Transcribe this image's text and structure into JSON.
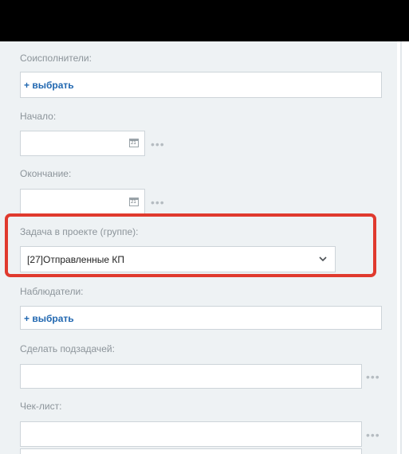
{
  "form": {
    "coexecutors_label": "Соисполнители:",
    "coexecutors_pick": "+ выбрать",
    "start_label": "Начало:",
    "start_value": "",
    "end_label": "Окончание:",
    "end_value": "",
    "calendar_day": "21",
    "project_label": "Задача в проекте (группе):",
    "project_value": "[27]Отправленные КП",
    "observers_label": "Наблюдатели:",
    "observers_pick": "+ выбрать",
    "subtask_label": "Сделать подзадачей:",
    "subtask_value": "",
    "checklist_label": "Чек-лист:",
    "checklist_value": "",
    "more_glyph": "•••"
  },
  "colors": {
    "highlight": "#e03a2e",
    "link": "#2067b0"
  }
}
